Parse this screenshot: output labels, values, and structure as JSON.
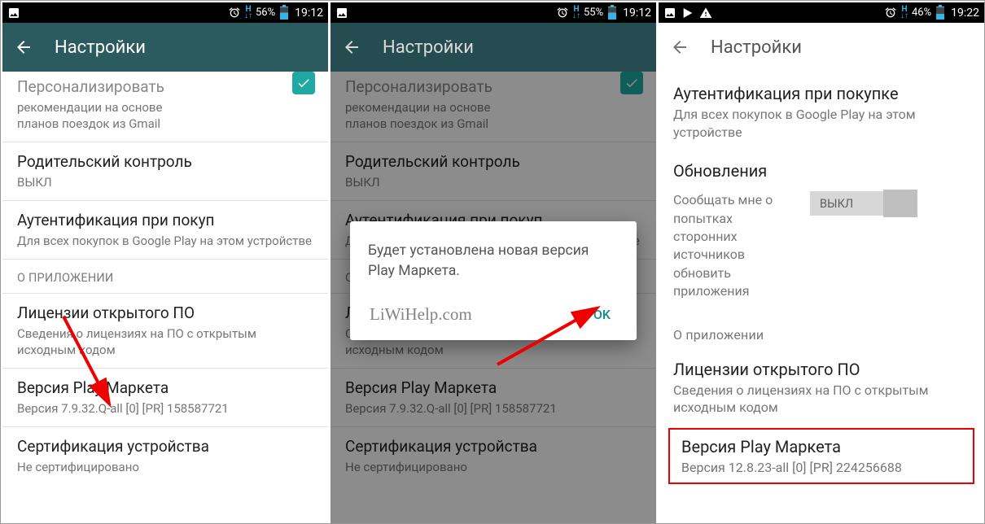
{
  "left": {
    "status": {
      "battery": "56%",
      "time": "19:12"
    },
    "appbar_title": "Настройки",
    "trunc": {
      "cut_title": "Персонализировать",
      "line1": "рекомендации на основе",
      "line2": "планов поездок из Gmail"
    },
    "parental": {
      "title": "Родительский контроль",
      "sub": "ВЫКЛ"
    },
    "auth": {
      "title": "Аутентификация при покуп",
      "sub": "Для всех покупок в Google Play на этом устройстве"
    },
    "about_header": "О ПРИЛОЖЕНИИ",
    "license": {
      "title": "Лицензии открытого ПО",
      "sub": "Сведения о лицензиях на ПО с открытым исходным кодом"
    },
    "version": {
      "title": "Версия Play Маркета",
      "sub": "Версия 7.9.32.Q-all [0] [PR] 158587721"
    },
    "cert": {
      "title": "Сертификация устройства",
      "sub": "Не сертифицировано"
    }
  },
  "center": {
    "status": {
      "battery": "55%",
      "time": "19:12"
    },
    "appbar_title": "Настройки",
    "dialog": {
      "text": "Будет установлена новая версия Play Маркета.",
      "ok": "OK",
      "watermark": "LiWiHelp.com"
    }
  },
  "right": {
    "status": {
      "battery": "46%",
      "time": "19:22"
    },
    "appbar_title": "Настройки",
    "auth": {
      "title": "Аутентификация при покупке",
      "sub": "Для всех покупок в Google Play на этом устройстве"
    },
    "updates": {
      "title": "Обновления",
      "sub": "Сообщать мне о попытках сторонних источников обновить приложения",
      "switch": "ВЫКЛ"
    },
    "about_header": "О приложении",
    "license": {
      "title": "Лицензии открытого ПО",
      "sub": "Сведения о лицензиях на ПО с открытым исходным кодом"
    },
    "version": {
      "title": "Версия Play Маркета",
      "sub": "Версия 12.8.23-all [0] [PR] 224256688"
    }
  }
}
